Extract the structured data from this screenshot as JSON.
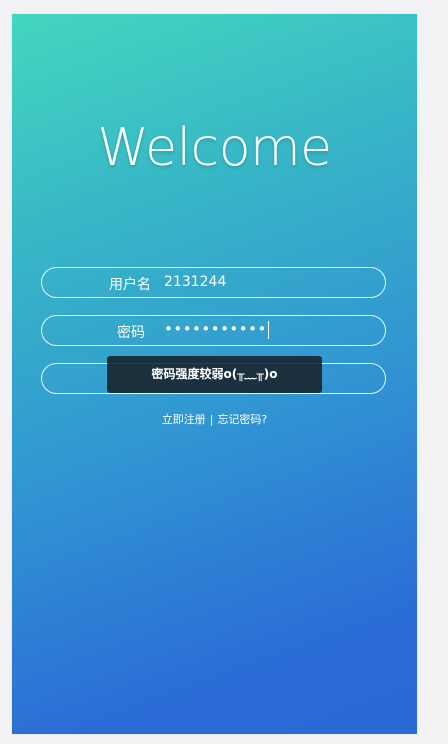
{
  "welcome_title": "Welcome",
  "form": {
    "username_label": "用户名",
    "username_value": "2131244",
    "password_label": "密码",
    "password_value": "•••••••••••"
  },
  "toast_message": "密码强度较弱o(╥﹏╥)o",
  "links": {
    "register": "立即注册",
    "separator": "|",
    "forgot_password": "忘记密码?"
  },
  "colors": {
    "gradient_top": "#44d6bf",
    "gradient_bottom": "#2a69d6",
    "toast_bg": "#18222a"
  }
}
